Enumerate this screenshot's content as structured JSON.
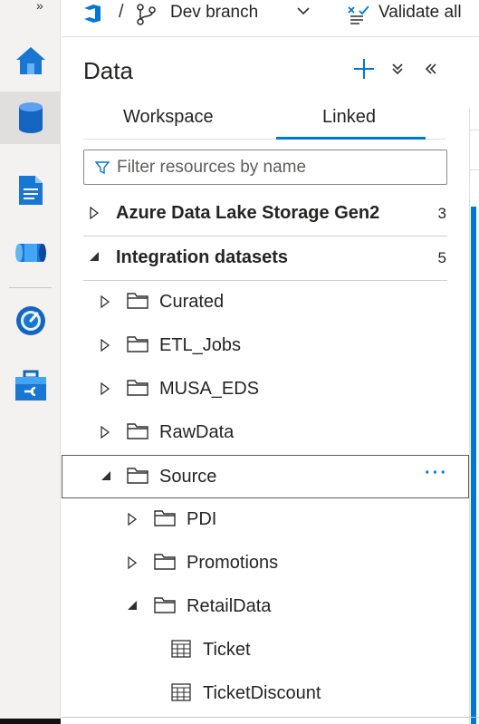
{
  "topbar": {
    "separator": "/",
    "branch": "Dev branch",
    "validate": "Validate all",
    "expand": "»"
  },
  "panel": {
    "title": "Data",
    "tabs": [
      {
        "label": "Workspace",
        "active": false
      },
      {
        "label": "Linked",
        "active": true
      }
    ],
    "search": {
      "placeholder": "Filter resources by name",
      "value": ""
    }
  },
  "tree": {
    "adls": {
      "label": "Azure Data Lake Storage Gen2",
      "count": "3",
      "expanded": false
    },
    "integration": {
      "label": "Integration datasets",
      "count": "5",
      "expanded": true
    },
    "curated": {
      "label": "Curated",
      "expanded": false
    },
    "etl": {
      "label": "ETL_Jobs",
      "expanded": false
    },
    "musa": {
      "label": "MUSA_EDS",
      "expanded": false
    },
    "rawdata": {
      "label": "RawData",
      "expanded": false
    },
    "source": {
      "label": "Source",
      "expanded": true,
      "more": "···"
    },
    "pdi": {
      "label": "PDI",
      "expanded": false
    },
    "promotions": {
      "label": "Promotions",
      "expanded": false
    },
    "retaildata": {
      "label": "RetailData",
      "expanded": true
    },
    "ticket": {
      "label": "Ticket"
    },
    "ticketdiscount": {
      "label": "TicketDiscount"
    }
  },
  "colors": {
    "accent": "#0078d4",
    "text": "#252423",
    "rail": "#f3f2f1"
  }
}
